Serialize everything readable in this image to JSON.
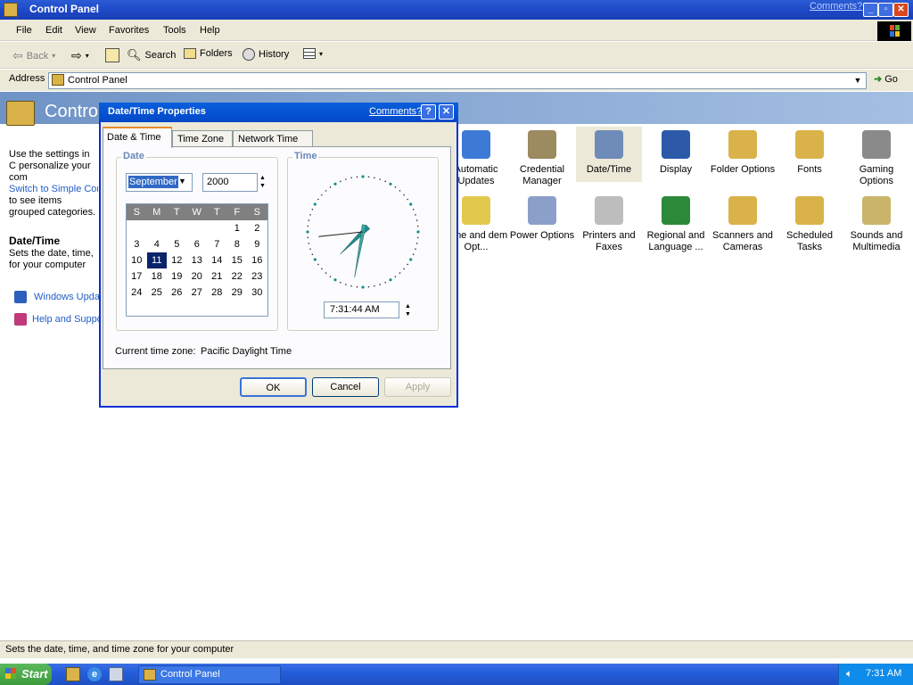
{
  "window": {
    "title": "Control Panel",
    "comments": "Comments?"
  },
  "menu": [
    "File",
    "Edit",
    "View",
    "Favorites",
    "Tools",
    "Help"
  ],
  "toolbar": {
    "back": "Back",
    "search": "Search",
    "folders": "Folders",
    "history": "History"
  },
  "address": {
    "label": "Address",
    "value": "Control Panel",
    "go": "Go"
  },
  "left_panel": {
    "title": "Contro",
    "intro": "Use the settings in C personalize your com",
    "switch_link": "Switch to Simple Con",
    "switch_text": "to see items grouped categories.",
    "section_title": "Date/Time",
    "section_desc": "Sets the date, time, for your computer",
    "links": [
      "Windows Upda",
      "Help and Suppo"
    ]
  },
  "icons_row1": [
    {
      "label": "Automatic Updates",
      "icon": "globe-shield-icon"
    },
    {
      "label": "Credential Manager",
      "icon": "keys-icon"
    },
    {
      "label": "Date/Time",
      "icon": "calendar-clock-icon"
    },
    {
      "label": "Display",
      "icon": "monitor-icon"
    },
    {
      "label": "Folder Options",
      "icon": "folder-icon"
    },
    {
      "label": "Fonts",
      "icon": "fonts-folder-icon"
    },
    {
      "label": "Gaming Options",
      "icon": "joystick-icon"
    }
  ],
  "icons_row2": [
    {
      "label": "hone and dem Opt...",
      "icon": "phone-icon"
    },
    {
      "label": "Power Options",
      "icon": "power-plug-icon"
    },
    {
      "label": "Printers and Faxes",
      "icon": "printer-icon"
    },
    {
      "label": "Regional and Language ...",
      "icon": "globe-icon"
    },
    {
      "label": "Scanners and Cameras",
      "icon": "scanner-camera-icon"
    },
    {
      "label": "Scheduled Tasks",
      "icon": "scheduled-folder-icon"
    },
    {
      "label": "Sounds and Multimedia",
      "icon": "speaker-icon"
    }
  ],
  "dialog": {
    "title": "Date/Time Properties",
    "comments": "Comments?",
    "tabs": [
      "Date & Time",
      "Time Zone",
      "Network Time"
    ],
    "date_group": "Date",
    "time_group": "Time",
    "month": "September",
    "year": "2000",
    "weekdays": [
      "S",
      "M",
      "T",
      "W",
      "T",
      "F",
      "S"
    ],
    "weeks": [
      [
        "",
        "",
        "",
        "",
        "",
        "1",
        "2"
      ],
      [
        "3",
        "4",
        "5",
        "6",
        "7",
        "8",
        "9"
      ],
      [
        "10",
        "11",
        "12",
        "13",
        "14",
        "15",
        "16"
      ],
      [
        "17",
        "18",
        "19",
        "20",
        "21",
        "22",
        "23"
      ],
      [
        "24",
        "25",
        "26",
        "27",
        "28",
        "29",
        "30"
      ]
    ],
    "selected_day": "11",
    "time": "7:31:44 AM",
    "timezone_label": "Current time zone:",
    "timezone_value": "Pacific Daylight Time",
    "ok": "OK",
    "cancel": "Cancel",
    "apply": "Apply"
  },
  "status": "Sets the date, time, and time zone for your computer",
  "taskbar": {
    "start": "Start",
    "app": "Control Panel",
    "clock": "7:31 AM"
  }
}
